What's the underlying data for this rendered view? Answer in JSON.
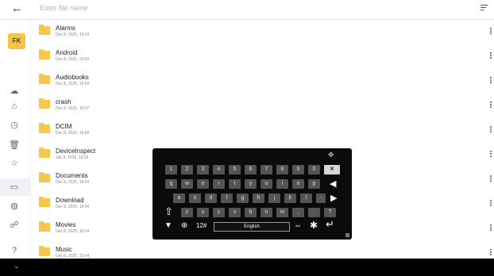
{
  "header": {
    "back_icon": "arrow-left-icon",
    "search_placeholder": "Enter file name",
    "sort_icon": "sort-icon"
  },
  "app": {
    "logo_text": "FK"
  },
  "rail": [
    {
      "icon": "cloud-upload-icon"
    },
    {
      "icon": "home-icon"
    },
    {
      "icon": "clock-icon"
    },
    {
      "icon": "trash-icon"
    },
    {
      "icon": "star-icon"
    },
    {
      "icon": "monitor-icon",
      "selected": true
    },
    {
      "icon": "globe-icon"
    },
    {
      "icon": "network-icon"
    },
    {
      "icon": "help-icon"
    }
  ],
  "files": [
    {
      "name": "Alarms",
      "date": "Dec 8, 2025, 19:04"
    },
    {
      "name": "Android",
      "date": "Dec 8, 2025, 19:03"
    },
    {
      "name": "Audiobooks",
      "date": "Dec 8, 2025, 19:04"
    },
    {
      "name": "crash",
      "date": "Dec 8, 2025, 19:07"
    },
    {
      "name": "DCIM",
      "date": "Dec 8, 2025, 19:04"
    },
    {
      "name": "DeviceInspect",
      "date": "Jan 8, 2026, 16:36"
    },
    {
      "name": "Documents",
      "date": "Dec 8, 2025, 19:04"
    },
    {
      "name": "Download",
      "date": "Dec 8, 2025, 19:04"
    },
    {
      "name": "Movies",
      "date": "Dec 8, 2025, 19:04"
    },
    {
      "name": "Music",
      "date": "Dec 8, 2025, 19:04"
    }
  ],
  "keyboard": {
    "row1": [
      "1",
      "2",
      "3",
      "4",
      "5",
      "6",
      "7",
      "8",
      "9",
      "0"
    ],
    "row2": [
      "q",
      "w",
      "e",
      "r",
      "t",
      "y",
      "u",
      "i",
      "o",
      "p"
    ],
    "row3": [
      "a",
      "s",
      "d",
      "f",
      "g",
      "h",
      "j",
      "k",
      "l",
      "-"
    ],
    "row4": [
      "z",
      "x",
      "c",
      "v",
      "b",
      "n",
      "m",
      ",",
      ".",
      "?"
    ],
    "mode_label": "12#",
    "space_label": "English"
  }
}
